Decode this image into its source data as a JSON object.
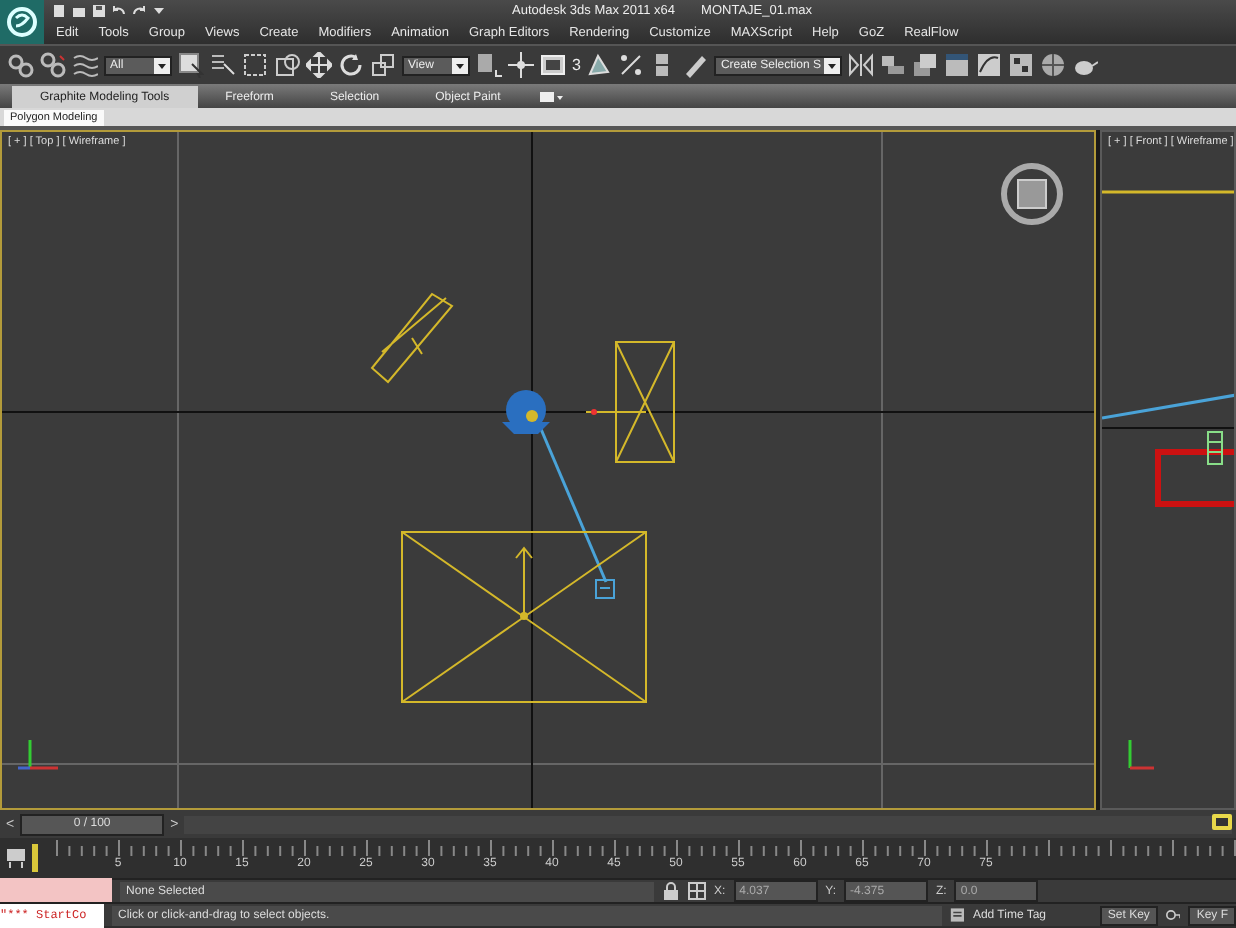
{
  "title_bar": {
    "title": "Autodesk 3ds Max 2011 x64",
    "file": "MONTAJE_01.max"
  },
  "menu": [
    "Edit",
    "Tools",
    "Group",
    "Views",
    "Create",
    "Modifiers",
    "Animation",
    "Graph Editors",
    "Rendering",
    "Customize",
    "MAXScript",
    "Help",
    "GoZ",
    "RealFlow"
  ],
  "toolbar": {
    "selection_filter": "All",
    "reference_coordinate": "View",
    "snap_label": "3",
    "named_selection": "Create Selection S"
  },
  "ribbon": {
    "tabs": [
      {
        "label": "Graphite Modeling Tools",
        "selected": true
      },
      {
        "label": "Freeform",
        "selected": false
      },
      {
        "label": "Selection",
        "selected": false
      },
      {
        "label": "Object Paint",
        "selected": false
      }
    ],
    "panel_tab": "Polygon Modeling"
  },
  "viewports": [
    {
      "label": "[ + ] [ Top ] [ Wireframe ]",
      "active": true
    },
    {
      "label": "[ + ] [ Front ] [ Wireframe ]",
      "active": false
    }
  ],
  "time_slider": {
    "prev": "<",
    "position": "0 / 100",
    "next": ">"
  },
  "track_ticks": [
    "5",
    "10",
    "15",
    "20",
    "25",
    "30",
    "35",
    "40",
    "45",
    "50",
    "55",
    "60",
    "65",
    "70",
    "75"
  ],
  "status": {
    "listener_output": "\"*** StartCo",
    "selection": "None Selected",
    "coordinates": [
      {
        "axis": "X:",
        "value": "4.037"
      },
      {
        "axis": "Y:",
        "value": "-4.375"
      },
      {
        "axis": "Z:",
        "value": "0.0"
      }
    ],
    "prompt": "Click or click-and-drag to select objects.",
    "time_tag": "Add Time Tag",
    "set_key": "Set Key",
    "key_filters": "Key F"
  }
}
